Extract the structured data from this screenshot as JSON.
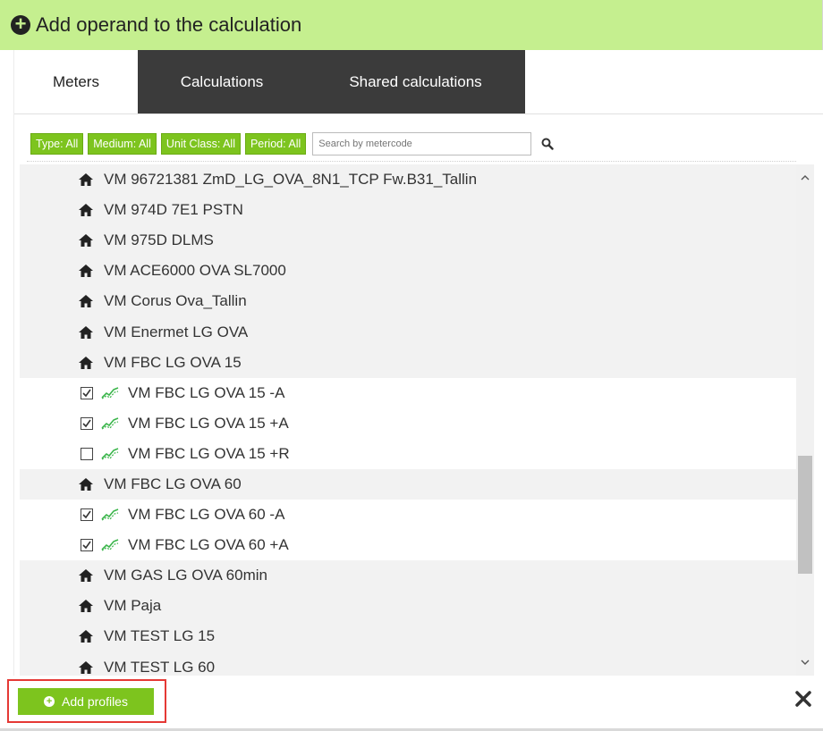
{
  "header": {
    "title": "Add operand to the calculation"
  },
  "tabs": [
    {
      "label": "Meters"
    },
    {
      "label": "Calculations"
    },
    {
      "label": "Shared calculations"
    }
  ],
  "filters": {
    "type": "Type: All",
    "medium": "Medium: All",
    "unit_class": "Unit Class: All",
    "period": "Period: All",
    "search_placeholder": "Search by metercode"
  },
  "rows": [
    {
      "kind": "meter",
      "label": "VM 96721381 ZmD_LG_OVA_8N1_TCP Fw.B31_Tallin"
    },
    {
      "kind": "meter",
      "label": "VM 974D 7E1 PSTN"
    },
    {
      "kind": "meter",
      "label": "VM 975D DLMS"
    },
    {
      "kind": "meter",
      "label": "VM ACE6000 OVA SL7000"
    },
    {
      "kind": "meter",
      "label": "VM Corus Ova_Tallin"
    },
    {
      "kind": "meter",
      "label": "VM Enermet LG OVA"
    },
    {
      "kind": "meter",
      "label": "VM FBC LG OVA 15"
    },
    {
      "kind": "profile",
      "checked": true,
      "label": "VM FBC LG OVA 15 -A"
    },
    {
      "kind": "profile",
      "checked": true,
      "label": "VM FBC LG OVA 15 +A"
    },
    {
      "kind": "profile",
      "checked": false,
      "label": "VM FBC LG OVA 15 +R"
    },
    {
      "kind": "meter",
      "label": "VM FBC LG OVA 60"
    },
    {
      "kind": "profile",
      "checked": true,
      "label": "VM FBC LG OVA 60 -A"
    },
    {
      "kind": "profile",
      "checked": true,
      "label": "VM FBC LG OVA 60 +A"
    },
    {
      "kind": "meter",
      "label": "VM GAS LG OVA 60min"
    },
    {
      "kind": "meter",
      "label": "VM Paja"
    },
    {
      "kind": "meter",
      "label": "VM TEST LG 15"
    },
    {
      "kind": "meter",
      "label": "VM TEST LG 60"
    }
  ],
  "footer": {
    "add_label": "Add profiles"
  },
  "colors": {
    "header_bg": "#c5ef8f",
    "accent": "#7dc41e",
    "dark_tab": "#3b3b3b",
    "highlight": "#e53935"
  }
}
